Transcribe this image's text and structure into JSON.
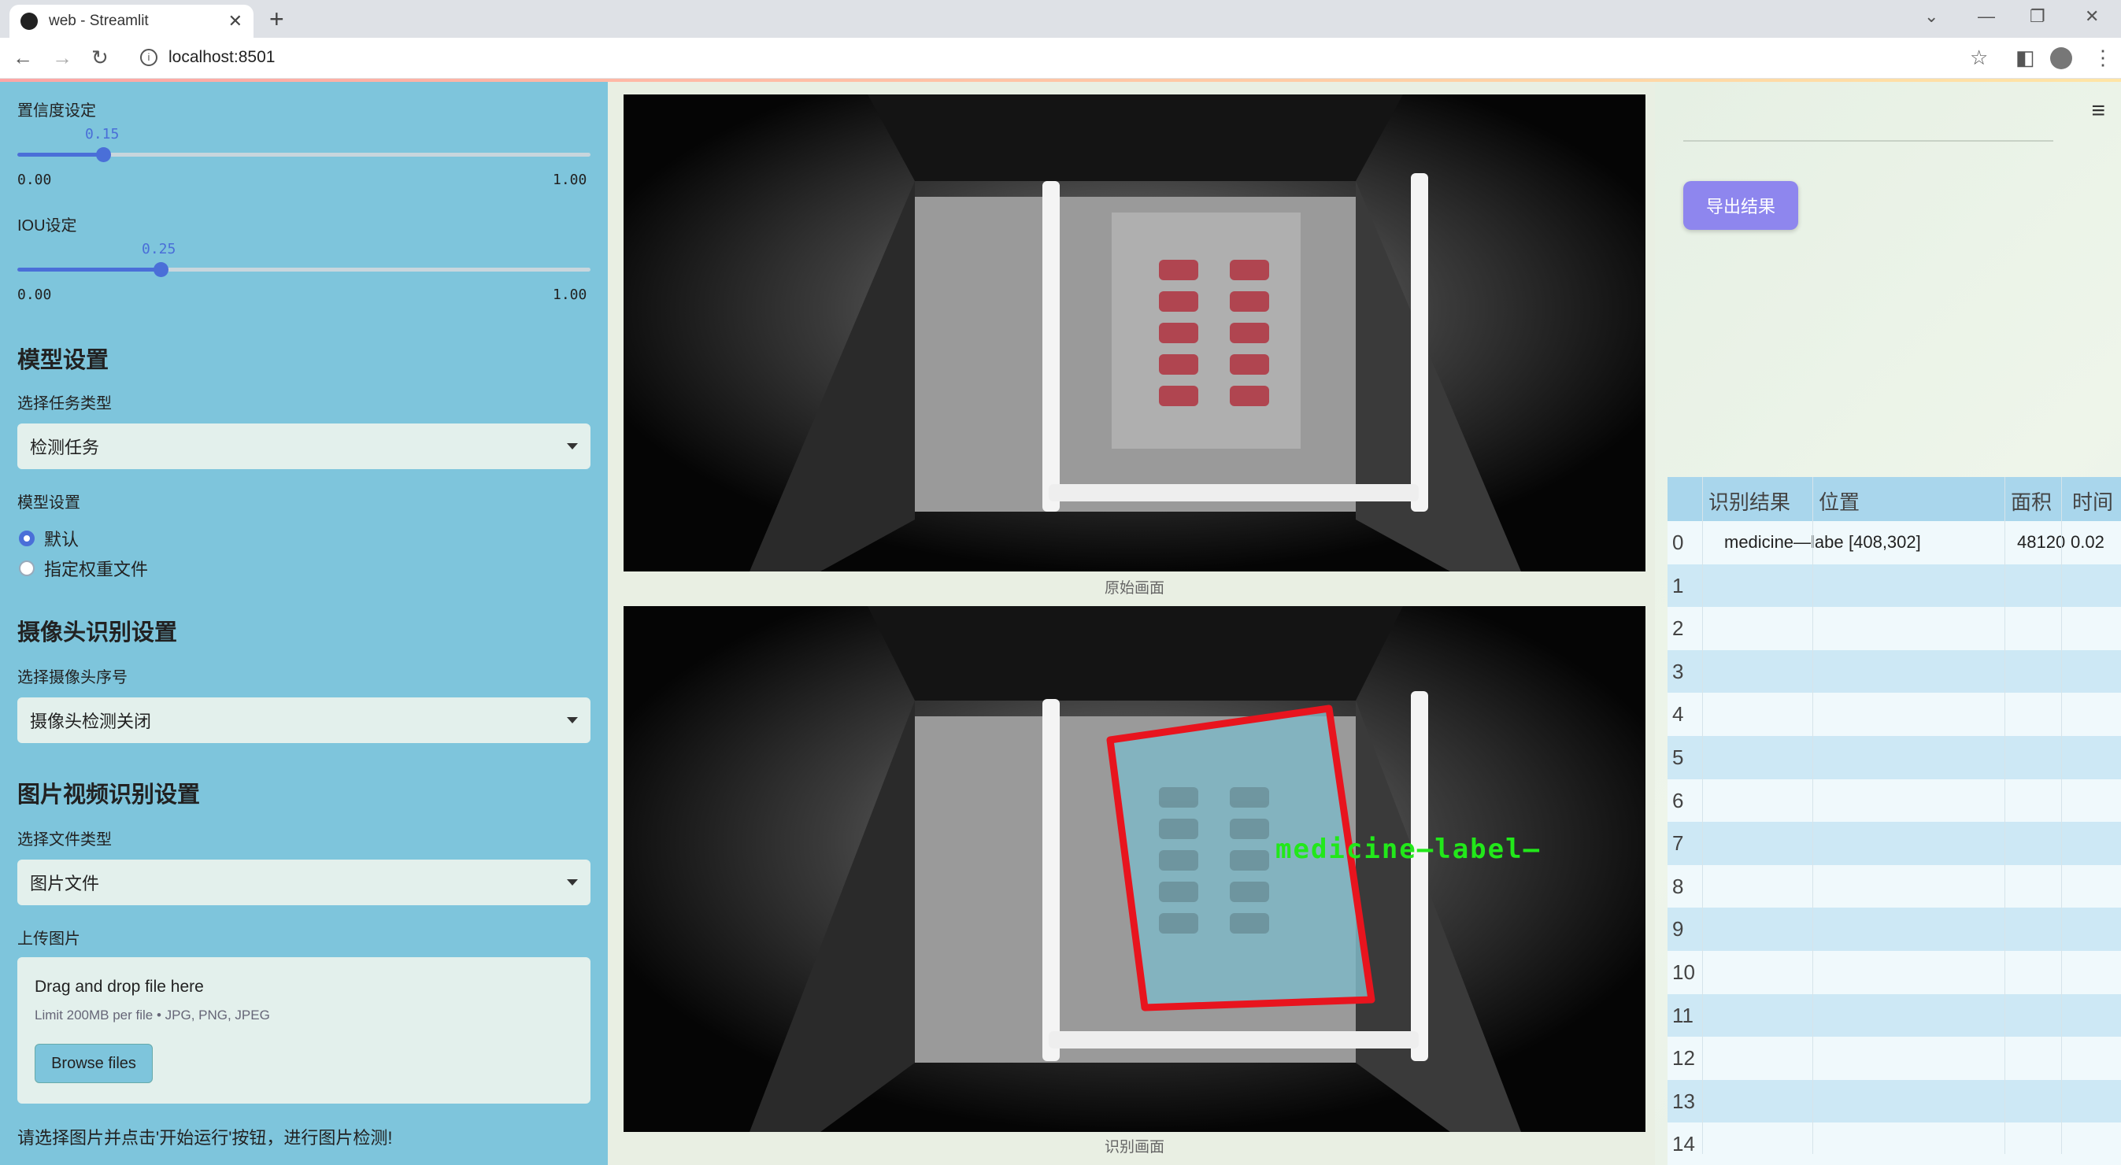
{
  "browser": {
    "tab_title": "web - Streamlit",
    "url": "localhost:8501"
  },
  "sidebar": {
    "confidence": {
      "label": "置信度设定",
      "value": "0.15",
      "fraction": 0.15,
      "min": "0.00",
      "max": "1.00"
    },
    "iou": {
      "label": "IOU设定",
      "value": "0.25",
      "fraction": 0.25,
      "min": "0.00",
      "max": "1.00"
    },
    "model_section": {
      "header": "模型设置",
      "task_label": "选择任务类型",
      "task_value": "检测任务",
      "model_label": "模型设置",
      "options": [
        "默认",
        "指定权重文件"
      ],
      "selected": "默认"
    },
    "camera_section": {
      "header": "摄像头识别设置",
      "label": "选择摄像头序号",
      "value": "摄像头检测关闭"
    },
    "media_section": {
      "header": "图片视频识别设置",
      "file_type_label": "选择文件类型",
      "file_type_value": "图片文件",
      "upload_label": "上传图片",
      "drop_text": "Drag and drop file here",
      "limit_text": "Limit 200MB per file • JPG, PNG, JPEG",
      "browse_label": "Browse files"
    },
    "hint": "请选择图片并点击'开始运行'按钮，进行图片检测!"
  },
  "main": {
    "original_caption": "原始画面",
    "detected_caption": "识别画面",
    "detection_label": "medicine—label—",
    "export_label": "导出结果",
    "colors": {
      "box": "#e8141e",
      "label": "#22e81a",
      "accent": "#4a6fd8",
      "sidebar": "#7ec5dc"
    }
  },
  "table": {
    "headers": [
      "识别结果",
      "位置",
      "面积",
      "时间"
    ],
    "rows": [
      {
        "idx": "0",
        "result": "medicine—labe",
        "position": "[408,302]",
        "area": "48120",
        "time": "0.02"
      },
      {
        "idx": "1"
      },
      {
        "idx": "2"
      },
      {
        "idx": "3"
      },
      {
        "idx": "4"
      },
      {
        "idx": "5"
      },
      {
        "idx": "6"
      },
      {
        "idx": "7"
      },
      {
        "idx": "8"
      },
      {
        "idx": "9"
      },
      {
        "idx": "10"
      },
      {
        "idx": "11"
      },
      {
        "idx": "12"
      },
      {
        "idx": "13"
      },
      {
        "idx": "14"
      }
    ]
  }
}
